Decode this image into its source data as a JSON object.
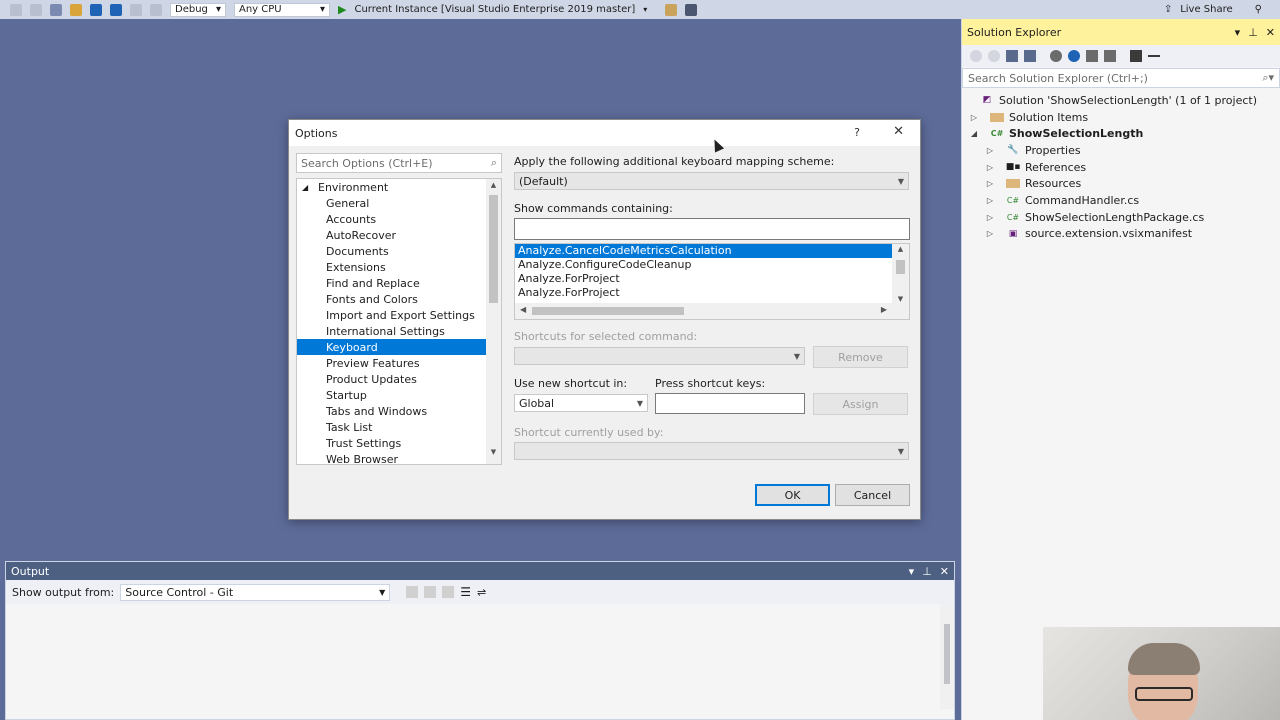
{
  "toolbar": {
    "configuration": "Debug",
    "platform": "Any CPU",
    "run_target": "Current Instance [Visual Studio Enterprise 2019 master]",
    "live_share": "Live Share"
  },
  "solution_explorer": {
    "title": "Solution Explorer",
    "search_placeholder": "Search Solution Explorer (Ctrl+;)",
    "items": [
      {
        "label": "Solution 'ShowSelectionLength' (1 of 1 project)",
        "icon": "solution-icon"
      },
      {
        "label": "Solution Items",
        "icon": "folder-icon"
      },
      {
        "label": "ShowSelectionLength",
        "icon": "csharp-project-icon"
      },
      {
        "label": "Properties",
        "icon": "wrench-icon"
      },
      {
        "label": "References",
        "icon": "references-icon"
      },
      {
        "label": "Resources",
        "icon": "folder-icon"
      },
      {
        "label": "CommandHandler.cs",
        "icon": "csharp-file-icon"
      },
      {
        "label": "ShowSelectionLengthPackage.cs",
        "icon": "csharp-file-icon"
      },
      {
        "label": "source.extension.vsixmanifest",
        "icon": "manifest-icon"
      }
    ]
  },
  "output": {
    "title": "Output",
    "show_output_label": "Show output from:",
    "source": "Source Control - Git"
  },
  "dialog": {
    "title": "Options",
    "help": "?",
    "search_placeholder": "Search Options (Ctrl+E)",
    "tree_root": "Environment",
    "tree_items": [
      "General",
      "Accounts",
      "AutoRecover",
      "Documents",
      "Extensions",
      "Find and Replace",
      "Fonts and Colors",
      "Import and Export Settings",
      "International Settings",
      "Keyboard",
      "Preview Features",
      "Product Updates",
      "Startup",
      "Tabs and Windows",
      "Task List",
      "Trust Settings",
      "Web Browser"
    ],
    "selected_item": "Keyboard",
    "mapping_label": "Apply the following additional keyboard mapping scheme:",
    "mapping_value": "(Default)",
    "show_commands_label": "Show commands containing:",
    "show_commands_value": "",
    "commands": [
      "Analyze.CancelCodeMetricsCalculation",
      "Analyze.ConfigureCodeCleanup",
      "Analyze.ForProject",
      "Analyze.ForProject"
    ],
    "shortcuts_label": "Shortcuts for selected command:",
    "remove_button": "Remove",
    "use_new_label": "Use new shortcut in:",
    "use_new_value": "Global",
    "press_keys_label": "Press shortcut keys:",
    "press_keys_value": "",
    "assign_button": "Assign",
    "currently_used_label": "Shortcut currently used by:",
    "ok_button": "OK",
    "cancel_button": "Cancel"
  },
  "colors": {
    "accent": "#0078d7",
    "editor_bg": "#5d6b99",
    "panel_title_active": "#fff29d",
    "panel_title_inactive": "#4d6082"
  }
}
